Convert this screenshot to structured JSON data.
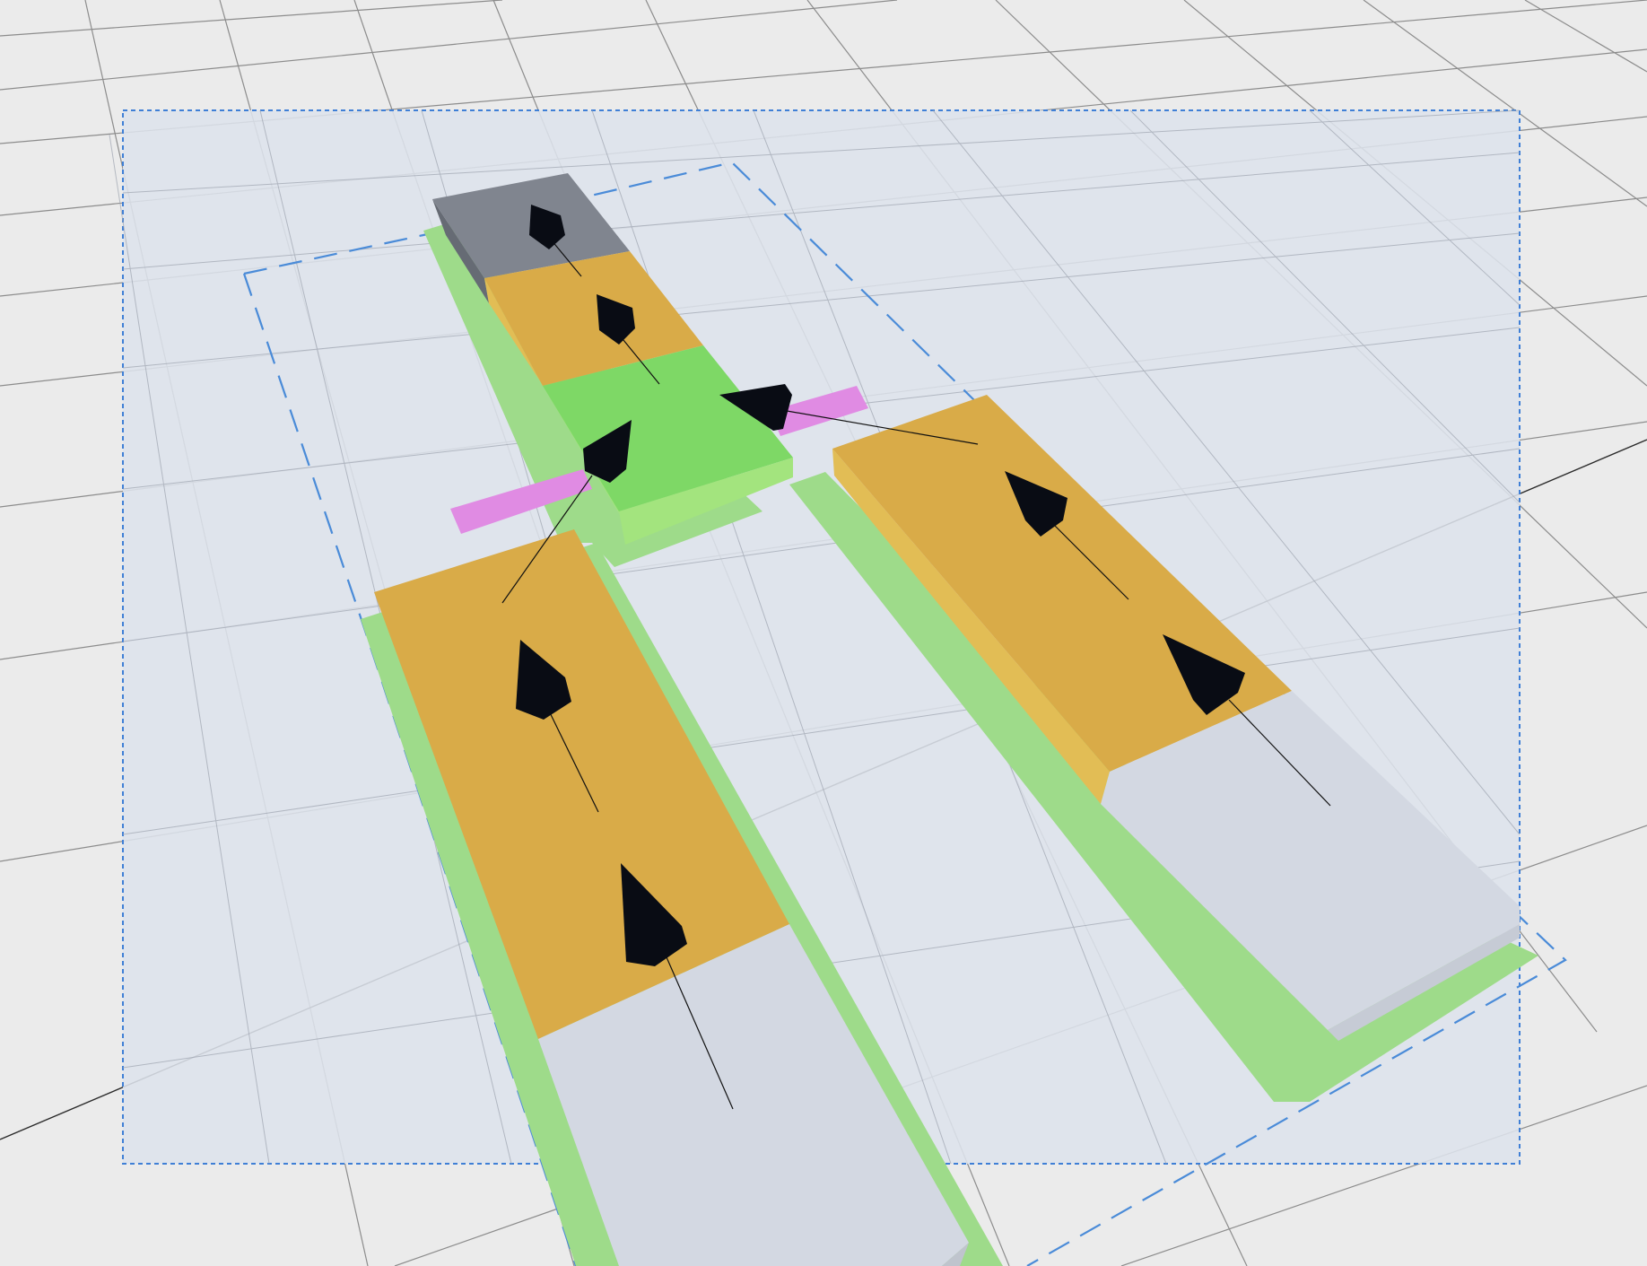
{
  "scene": {
    "view": "3d-perspective",
    "background_color": "#ebebeb",
    "grid_line_color": "#8c8c8c",
    "axis_line_color": "#2a2a2a",
    "selection": {
      "fill_color": "#dde2ec",
      "border_color": "#3f7fd6",
      "border_style": "dashed"
    },
    "bounds_outline": {
      "color": "#4a8bd8",
      "style": "dashed"
    },
    "colors": {
      "footprint_green": "#9edb8a",
      "module_orange": "#d9ab48",
      "module_orange_side": "#e2bd55",
      "module_gray": "#80858f",
      "module_green": "#7ed866",
      "module_green_side": "#a3e47e",
      "pending_slab": "#d3d8e2",
      "connector_magenta": "#e08be3",
      "arrow_marker": "#090c14"
    },
    "icons": [
      "direction-arrow-icon"
    ],
    "modules": [
      {
        "id": "gray-module",
        "kind": "gray block",
        "selected": true
      },
      {
        "id": "orange-module-top",
        "kind": "orange block",
        "selected": true
      },
      {
        "id": "green-junction",
        "kind": "green junction",
        "selected": true
      },
      {
        "id": "orange-module-left",
        "kind": "orange long block",
        "selected": true
      },
      {
        "id": "orange-module-right",
        "kind": "orange long block",
        "selected": true
      }
    ],
    "connectors": [
      {
        "id": "connector-left"
      },
      {
        "id": "connector-right"
      }
    ],
    "slabs": [
      {
        "id": "pending-slab-left"
      },
      {
        "id": "pending-slab-right"
      }
    ]
  }
}
